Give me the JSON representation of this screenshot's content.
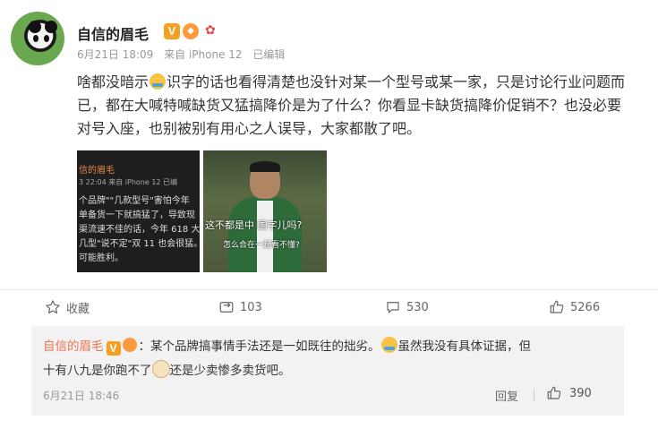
{
  "post": {
    "author": "自信的眉毛",
    "verified_mark": "V",
    "date": "6月21日 18:09",
    "source": "来自 iPhone 12",
    "edited": "已编辑",
    "text_a": "啥都没暗示",
    "text_b": "识字的话也看得清楚也没针对某一个型号或某一家，只是讨论行业问题而已，都在大喊特喊缺货又猛搞降价是为了什么？你看显卡缺货搞降价促销不？也没必要对号入座，也别被别有用心之人误导，大家都散了吧。"
  },
  "images": {
    "img1_lines": [
      "信的眉毛",
      "3 22:04 来自 iPhone 12 已编",
      "个品牌\"\"几款型号\"害怕今年",
      "单备货一下就搞猛了，导致现",
      "渠流速不佳的话，今年 618 大",
      "几型\"说不定\"双 11 也会很猛。",
      "可能胜利。"
    ],
    "img2_caption1": "这不都是中  国字儿吗?",
    "img2_caption2": "怎么合在一起看不懂?"
  },
  "actions": {
    "favorite_label": "收藏",
    "repost_count": "103",
    "comment_count": "530",
    "like_count": "5266"
  },
  "comment": {
    "author": "自信的眉毛",
    "verified_mark": "V",
    "text_a": "：某个品牌搞事情手法还是一如既往的拙劣。",
    "text_b": "虽然我没有具体证据，但",
    "text_c": "十有八九是你跑不了",
    "text_d": "还是少卖惨多卖货吧。",
    "date": "6月21日 18:46",
    "reply_label": "回复",
    "like_count": "390"
  },
  "colors": {
    "name_link": "#eb7350",
    "verified": "#f4a024",
    "meta": "#999999"
  }
}
